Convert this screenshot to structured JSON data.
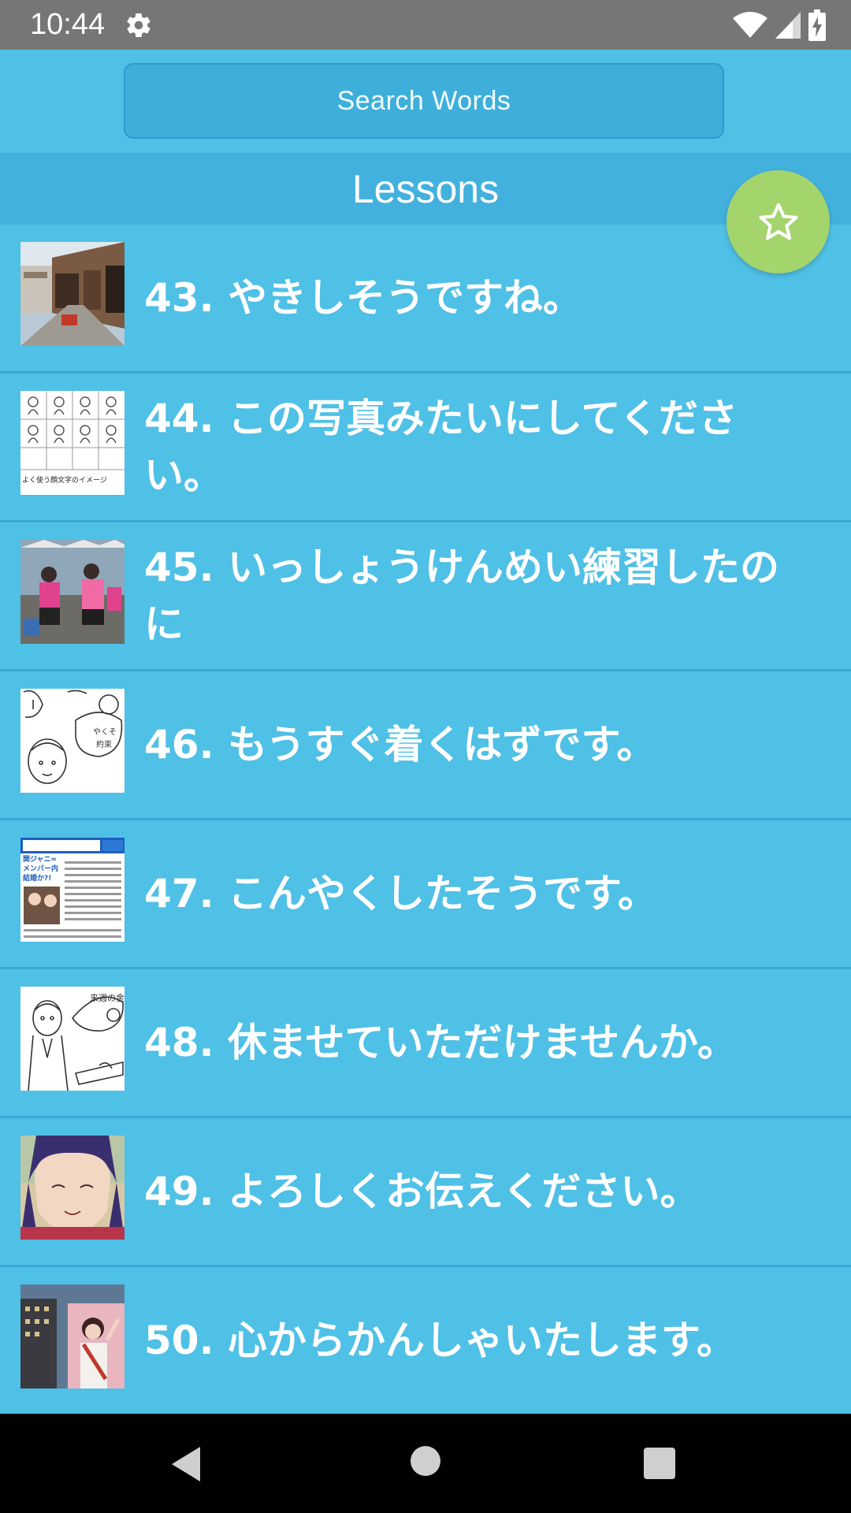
{
  "status_bar": {
    "time": "10:44",
    "icons": [
      "gear-icon",
      "wifi-icon",
      "signal-icon",
      "battery-charging-icon"
    ]
  },
  "search": {
    "label": "Search Words"
  },
  "header": {
    "title": "Lessons"
  },
  "fab": {
    "icon": "star-outline-icon"
  },
  "lessons": [
    {
      "title": "43. やきしそうですね。"
    },
    {
      "title": "44. この写真みたいにしてください。"
    },
    {
      "title": "45. いっしょうけんめい練習したのに"
    },
    {
      "title": "46. もうすぐ着くはずです。"
    },
    {
      "title": "47. こんやくしたそうです。"
    },
    {
      "title": "48. 休ませていただけませんか。"
    },
    {
      "title": "49. よろしくお伝えください。"
    },
    {
      "title": "50. 心からかんしゃいたします。"
    }
  ],
  "thumb_texts": {
    "lesson44": "よく使う顔文字のイメージ",
    "lesson47": "関ジャニ∞メンバー内結婚か?!"
  },
  "nav_bar": {
    "icons": [
      "back-icon",
      "home-icon",
      "recents-icon"
    ]
  },
  "colors": {
    "background": "#4fc0e6",
    "header": "#42b1de",
    "search_button": "#3eafdb",
    "fab": "#a4d46c",
    "status_bar": "#767676",
    "nav_bar": "#000000"
  }
}
